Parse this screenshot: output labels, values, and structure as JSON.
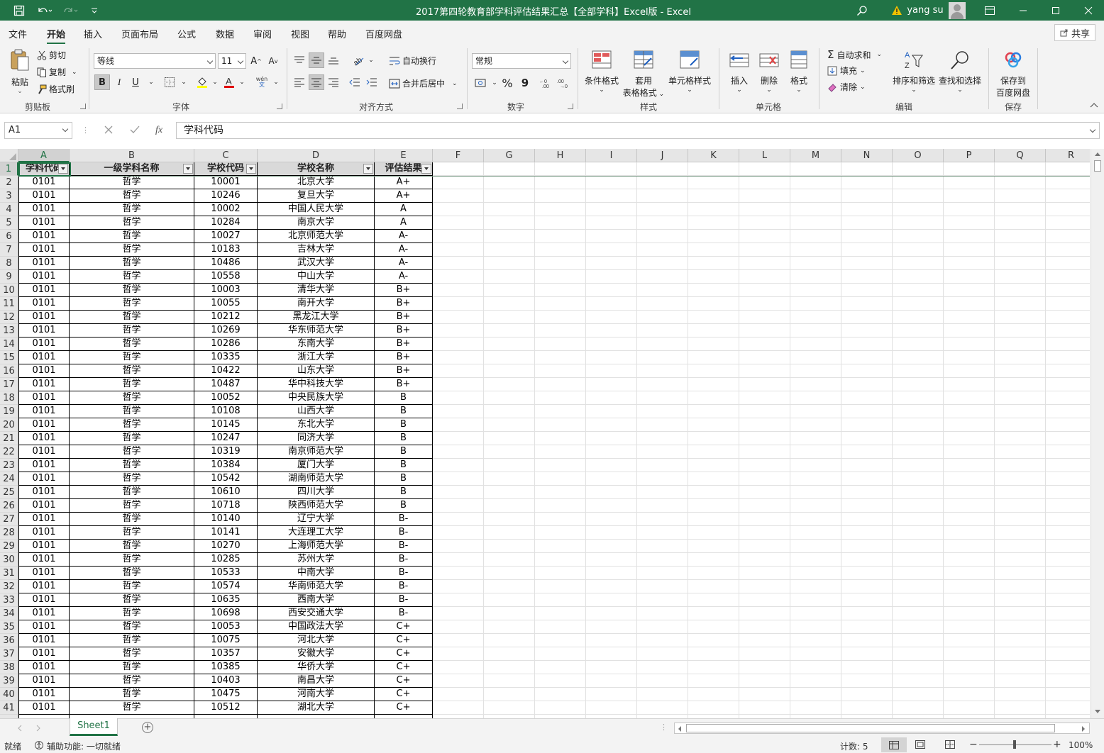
{
  "titlebar": {
    "title": "2017第四轮教育部学科评估结果汇总【全部学科】Excel版  -  Excel",
    "user": "yang su"
  },
  "menu": [
    "文件",
    "开始",
    "插入",
    "页面布局",
    "公式",
    "数据",
    "审阅",
    "视图",
    "帮助",
    "百度网盘"
  ],
  "share_label": "共享",
  "ribbon": {
    "clipboard": {
      "paste": "粘贴",
      "cut": "剪切",
      "copy": "复制",
      "painter": "格式刷",
      "label": "剪贴板"
    },
    "font": {
      "name": "等线",
      "size": "11",
      "grow": "A",
      "shrink": "A",
      "bold": "B",
      "italic": "I",
      "underline": "U",
      "wen": "wén",
      "label": "字体"
    },
    "align": {
      "wrap": "自动换行",
      "merge": "合并后居中",
      "label": "对齐方式"
    },
    "number": {
      "format": "常规",
      "percent": "%",
      "comma": "9",
      "label": "数字"
    },
    "styles": {
      "cond": "条件格式",
      "table_1": "套用",
      "table_2": "表格格式",
      "cell": "单元格样式",
      "label": "样式"
    },
    "cells": {
      "insert": "插入",
      "delete": "删除",
      "format": "格式",
      "label": "单元格"
    },
    "editing": {
      "autosum": "自动求和",
      "fill": "填充",
      "clear": "清除",
      "sort": "排序和筛选",
      "find": "查找和选择",
      "label": "编辑"
    },
    "save": {
      "line1": "保存到",
      "line2": "百度网盘",
      "label": "保存"
    }
  },
  "formula_bar": {
    "name_box": "A1",
    "fx": "fx",
    "content": "学科代码"
  },
  "columns": [
    "A",
    "B",
    "C",
    "D",
    "E",
    "F",
    "G",
    "H",
    "I",
    "J",
    "K",
    "L",
    "M",
    "N",
    "O",
    "P",
    "Q",
    "R"
  ],
  "row_numbers": [
    "1",
    "2",
    "3",
    "4",
    "5",
    "6",
    "7",
    "8",
    "9",
    "10",
    "11",
    "12",
    "13",
    "14",
    "15",
    "16",
    "17",
    "18",
    "19",
    "20",
    "21",
    "22",
    "23",
    "24",
    "25",
    "26",
    "27",
    "28",
    "29",
    "30",
    "31",
    "32",
    "33",
    "34",
    "35",
    "36",
    "37",
    "38",
    "39",
    "40",
    "41"
  ],
  "table": {
    "headers": [
      "学科代码",
      "一级学科名称",
      "学校代码",
      "学校名称",
      "评估结果"
    ],
    "rows": [
      [
        "0101",
        "哲学",
        "10001",
        "北京大学",
        "A+"
      ],
      [
        "0101",
        "哲学",
        "10246",
        "复旦大学",
        "A+"
      ],
      [
        "0101",
        "哲学",
        "10002",
        "中国人民大学",
        "A"
      ],
      [
        "0101",
        "哲学",
        "10284",
        "南京大学",
        "A"
      ],
      [
        "0101",
        "哲学",
        "10027",
        "北京师范大学",
        "A-"
      ],
      [
        "0101",
        "哲学",
        "10183",
        "吉林大学",
        "A-"
      ],
      [
        "0101",
        "哲学",
        "10486",
        "武汉大学",
        "A-"
      ],
      [
        "0101",
        "哲学",
        "10558",
        "中山大学",
        "A-"
      ],
      [
        "0101",
        "哲学",
        "10003",
        "清华大学",
        "B+"
      ],
      [
        "0101",
        "哲学",
        "10055",
        "南开大学",
        "B+"
      ],
      [
        "0101",
        "哲学",
        "10212",
        "黑龙江大学",
        "B+"
      ],
      [
        "0101",
        "哲学",
        "10269",
        "华东师范大学",
        "B+"
      ],
      [
        "0101",
        "哲学",
        "10286",
        "东南大学",
        "B+"
      ],
      [
        "0101",
        "哲学",
        "10335",
        "浙江大学",
        "B+"
      ],
      [
        "0101",
        "哲学",
        "10422",
        "山东大学",
        "B+"
      ],
      [
        "0101",
        "哲学",
        "10487",
        "华中科技大学",
        "B+"
      ],
      [
        "0101",
        "哲学",
        "10052",
        "中央民族大学",
        "B"
      ],
      [
        "0101",
        "哲学",
        "10108",
        "山西大学",
        "B"
      ],
      [
        "0101",
        "哲学",
        "10145",
        "东北大学",
        "B"
      ],
      [
        "0101",
        "哲学",
        "10247",
        "同济大学",
        "B"
      ],
      [
        "0101",
        "哲学",
        "10319",
        "南京师范大学",
        "B"
      ],
      [
        "0101",
        "哲学",
        "10384",
        "厦门大学",
        "B"
      ],
      [
        "0101",
        "哲学",
        "10542",
        "湖南师范大学",
        "B"
      ],
      [
        "0101",
        "哲学",
        "10610",
        "四川大学",
        "B"
      ],
      [
        "0101",
        "哲学",
        "10718",
        "陕西师范大学",
        "B"
      ],
      [
        "0101",
        "哲学",
        "10140",
        "辽宁大学",
        "B-"
      ],
      [
        "0101",
        "哲学",
        "10141",
        "大连理工大学",
        "B-"
      ],
      [
        "0101",
        "哲学",
        "10270",
        "上海师范大学",
        "B-"
      ],
      [
        "0101",
        "哲学",
        "10285",
        "苏州大学",
        "B-"
      ],
      [
        "0101",
        "哲学",
        "10533",
        "中南大学",
        "B-"
      ],
      [
        "0101",
        "哲学",
        "10574",
        "华南师范大学",
        "B-"
      ],
      [
        "0101",
        "哲学",
        "10635",
        "西南大学",
        "B-"
      ],
      [
        "0101",
        "哲学",
        "10698",
        "西安交通大学",
        "B-"
      ],
      [
        "0101",
        "哲学",
        "10053",
        "中国政法大学",
        "C+"
      ],
      [
        "0101",
        "哲学",
        "10075",
        "河北大学",
        "C+"
      ],
      [
        "0101",
        "哲学",
        "10357",
        "安徽大学",
        "C+"
      ],
      [
        "0101",
        "哲学",
        "10385",
        "华侨大学",
        "C+"
      ],
      [
        "0101",
        "哲学",
        "10403",
        "南昌大学",
        "C+"
      ],
      [
        "0101",
        "哲学",
        "10475",
        "河南大学",
        "C+"
      ],
      [
        "0101",
        "哲学",
        "10512",
        "湖北大学",
        "C+"
      ]
    ]
  },
  "sheet_tab": "Sheet1",
  "status": {
    "ready": "就绪",
    "accessibility": "辅助功能: 一切就绪",
    "count": "计数: 5",
    "zoom": "100%"
  },
  "colors": {
    "accent": "#217346",
    "ribbon_bg": "#f3f3f3",
    "header_fill": "#d9d9d9"
  }
}
